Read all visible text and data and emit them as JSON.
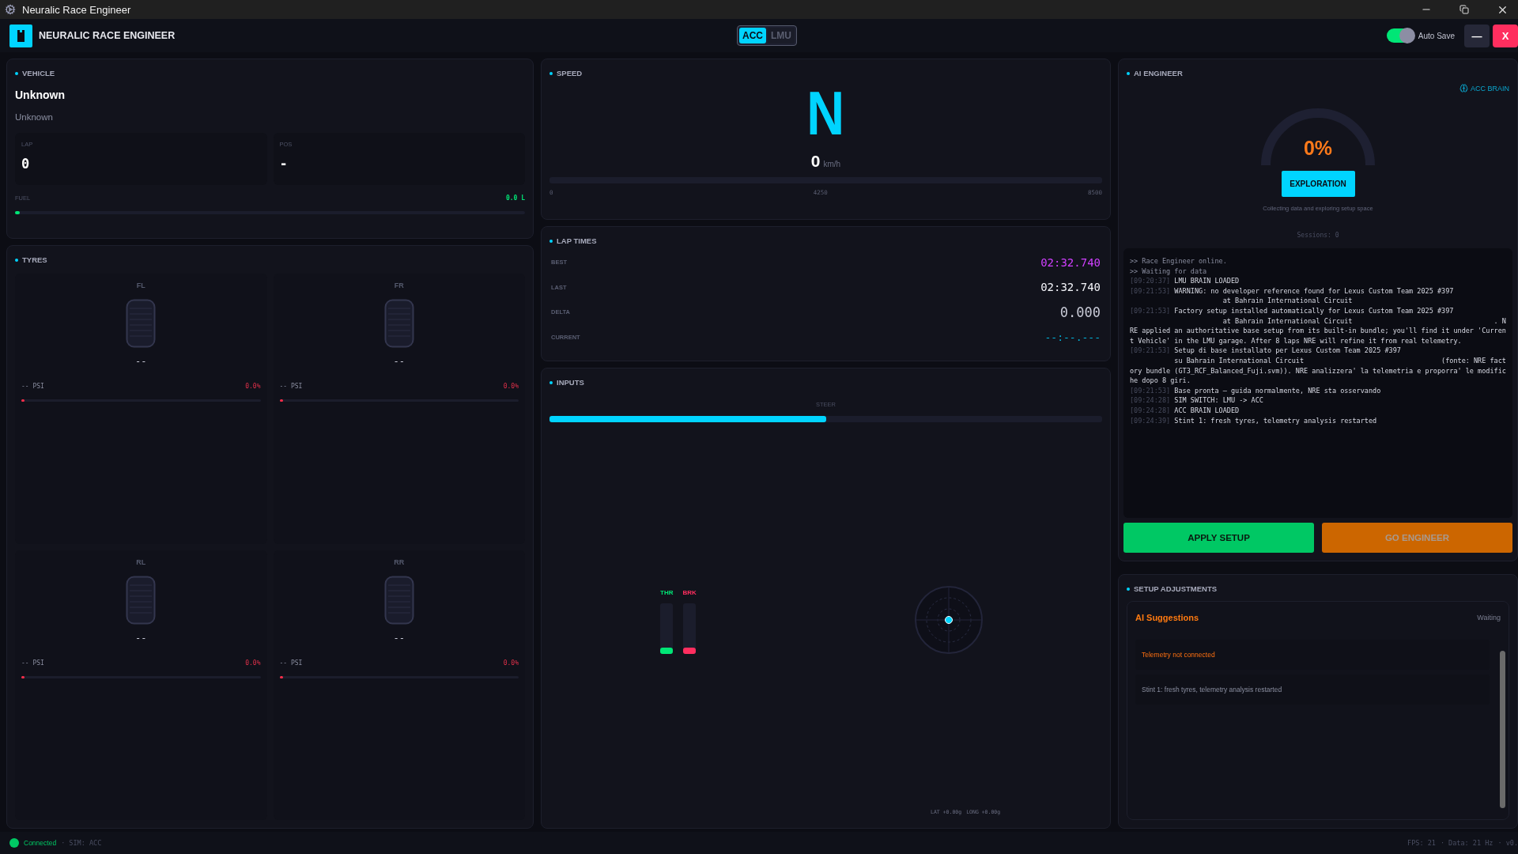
{
  "window": {
    "title": "Neuralic Race Engineer"
  },
  "header": {
    "title": "NEURALIC RACE ENGINEER",
    "sims": [
      {
        "label": "ACC",
        "selected": true
      },
      {
        "label": "LMU",
        "selected": false
      }
    ],
    "auto_save": {
      "label": "Auto Save",
      "on": true
    },
    "minimize_label": "—",
    "close_label": "X"
  },
  "vehicle": {
    "heading": "VEHICLE",
    "name": "Unknown",
    "class": "Unknown",
    "stats": [
      {
        "label": "LAP",
        "value": "0"
      },
      {
        "label": "POS",
        "value": "-"
      }
    ],
    "fuel": {
      "label": "FUEL",
      "reading": "0.0 L",
      "level": 0
    }
  },
  "tyres": {
    "heading": "TYRES",
    "items": [
      {
        "position": "FL",
        "temp": "--",
        "pressure": "-- PSI",
        "wear": "0.0%",
        "level": 0
      },
      {
        "position": "FR",
        "temp": "--",
        "pressure": "-- PSI",
        "wear": "0.0%",
        "level": 0
      },
      {
        "position": "RL",
        "temp": "--",
        "pressure": "-- PSI",
        "wear": "0.0%",
        "level": 0
      },
      {
        "position": "RR",
        "temp": "--",
        "pressure": "-- PSI",
        "wear": "0.0%",
        "level": 0
      }
    ]
  },
  "speed": {
    "heading": "SPEED",
    "gear": "N",
    "value": "0",
    "unit": "km/h",
    "rpm": {
      "ticks": [
        "0",
        "4250",
        "8500"
      ]
    }
  },
  "lap_times": {
    "heading": "LAP TIMES",
    "rows": [
      {
        "label": "BEST",
        "value": "02:32.740",
        "kind": "best"
      },
      {
        "label": "LAST",
        "value": "02:32.740",
        "kind": "last"
      },
      {
        "label": "DELTA",
        "value": "0.000",
        "kind": "delta"
      },
      {
        "label": "CURRENT",
        "value": "--:--.---",
        "kind": "current"
      }
    ]
  },
  "inputs": {
    "heading": "INPUTS",
    "steer": {
      "label": "STEER",
      "level": 0.5
    },
    "pedals": [
      {
        "label": "THR",
        "kind": "throttle",
        "level": 0
      },
      {
        "label": "BRK",
        "kind": "brake",
        "level": 0
      }
    ],
    "gforce": {
      "lat": "LAT +0.00g",
      "long": "LONG +0.00g"
    }
  },
  "ai_engineer": {
    "heading": "AI ENGINEER",
    "brain": "ACC BRAIN",
    "confidence": {
      "reading": "0%"
    },
    "phase": "EXPLORATION",
    "phase_note": "Collecting data and exploring setup space",
    "sessions": "Sessions: 0",
    "log": [
      {
        "message": ">> Race Engineer online."
      },
      {
        "message": ">> Waiting for data"
      },
      {
        "time": "[09:20:37]",
        "message": "LMU BRAIN LOADED"
      },
      {
        "time": "[09:21:53]",
        "message": "WARNING: no developer reference found for Lexus Custom Team 2025 #397\n                       at Bahrain International Circuit"
      },
      {
        "time": "[09:21:53]",
        "message": "Factory setup installed automatically for Lexus Custom Team 2025 #397\n                       at Bahrain International Circuit                                   . NRE applied an authoritative base setup from its built-in bundle; you'll find it under 'Current Vehicle' in the LMU garage. After 8 laps NRE will refine it from real telemetry."
      },
      {
        "time": "[09:21:53]",
        "message": "Setup di base installato per Lexus Custom Team 2025 #397\n           su Bahrain International Circuit                                  (fonte: NRE factory bundle (GT3_RCF_Balanced_Fuji.svm)). NRE analizzera' la telemetria e proporra' le modifiche dopo 8 giri."
      },
      {
        "time": "[09:21:53]",
        "message": "Base pronta — guida normalmente, NRE sta osservando"
      },
      {
        "time": "[09:24:28]",
        "message": "SIM SWITCH: LMU -> ACC"
      },
      {
        "time": "[09:24:28]",
        "message": "ACC BRAIN LOADED"
      },
      {
        "time": "[09:24:39]",
        "message": "Stint 1: fresh tyres, telemetry analysis restarted"
      }
    ],
    "actions": [
      {
        "label": "APPLY SETUP",
        "kind": "apply",
        "disabled": false
      },
      {
        "label": "GO ENGINEER",
        "kind": "engineer",
        "disabled": true
      }
    ]
  },
  "setup_adjustments": {
    "heading": "SETUP ADJUSTMENTS",
    "title": "AI Suggestions",
    "status": "Waiting",
    "items": [
      {
        "text": "Telemetry not connected",
        "kind": "warning"
      },
      {
        "text": "Stint 1: fresh tyres, telemetry analysis restarted",
        "kind": "info"
      }
    ]
  },
  "status_bar": {
    "connection": "Connected",
    "connected": true,
    "sim": "· SIM: ACC",
    "fps": "FPS: 21",
    "data_rate": "· Data: 21 Hz",
    "version": "· v0."
  }
}
